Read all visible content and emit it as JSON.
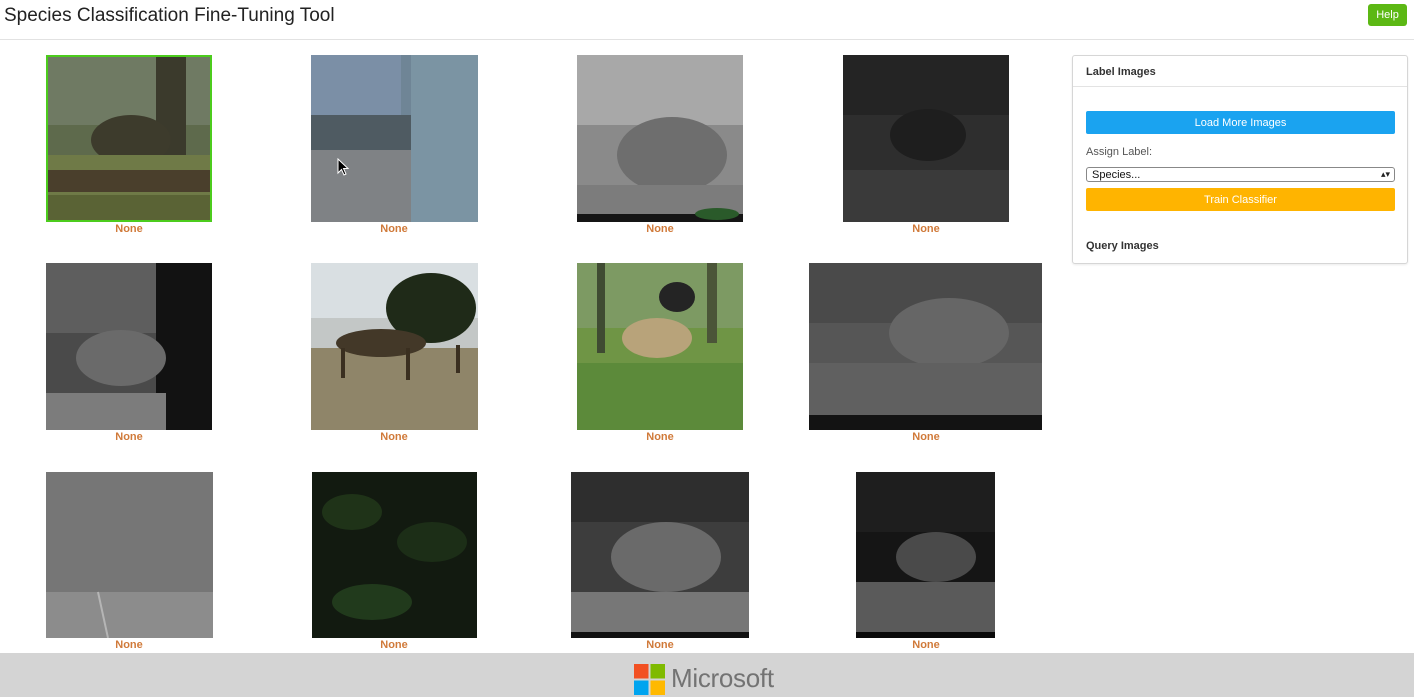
{
  "header": {
    "title": "Species Classification Fine-Tuning Tool",
    "help_label": "Help"
  },
  "gallery": {
    "images": [
      {
        "label": "None",
        "scene": "boar-in-grass",
        "selected": true
      },
      {
        "label": "None",
        "scene": "blurry-grey-blue",
        "selected": false
      },
      {
        "label": "None",
        "scene": "night-boar-leaves-reconyx",
        "selected": false
      },
      {
        "label": "None",
        "scene": "dark-night-animal",
        "selected": false
      },
      {
        "label": "None",
        "scene": "night-ferns",
        "selected": false
      },
      {
        "label": "None",
        "scene": "deer-herd",
        "selected": false
      },
      {
        "label": "None",
        "scene": "boars-in-forest",
        "selected": false
      },
      {
        "label": "None",
        "scene": "night-grey-forest",
        "selected": false
      },
      {
        "label": "None",
        "scene": "grey-night-empty",
        "selected": false
      },
      {
        "label": "None",
        "scene": "dark-green-foliage",
        "selected": false
      },
      {
        "label": "None",
        "scene": "night-boar-grey",
        "selected": false
      },
      {
        "label": "None",
        "scene": "night-boar-twigs",
        "selected": false
      }
    ]
  },
  "panel": {
    "heading": "Label Images",
    "load_more_label": "Load More Images",
    "assign_label_text": "Assign Label:",
    "species_select_value": "Species...",
    "train_label": "Train Classifier",
    "query_heading": "Query Images"
  },
  "footer": {
    "brand": "Microsoft"
  },
  "colors": {
    "help": "#5cb814",
    "load_more": "#1aa3f0",
    "train": "#ffb400",
    "label_text": "#d07a3a",
    "selected_border": "#4ccc1d"
  }
}
